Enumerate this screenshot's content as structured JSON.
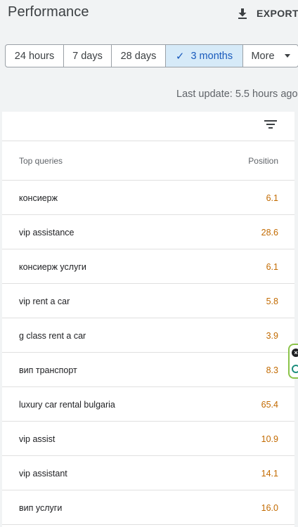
{
  "header": {
    "title": "Performance",
    "export_label": "EXPORT",
    "export_icon": "download-icon"
  },
  "date_range": {
    "options": [
      {
        "label": "24 hours",
        "selected": false
      },
      {
        "label": "7 days",
        "selected": false
      },
      {
        "label": "28 days",
        "selected": false
      },
      {
        "label": "3 months",
        "selected": true
      },
      {
        "label": "More",
        "selected": false
      }
    ],
    "check_glyph": "✓",
    "more_icon": "caret-down-icon"
  },
  "last_update": "Last update: 5.5 hours ago",
  "table": {
    "filter_icon": "filter-icon",
    "columns": {
      "query": "Top queries",
      "position": "Position"
    },
    "rows": [
      {
        "query": "консиерж",
        "position": "6.1"
      },
      {
        "query": "vip assistance",
        "position": "28.6"
      },
      {
        "query": "консиерж услуги",
        "position": "6.1"
      },
      {
        "query": "vip rent a car",
        "position": "5.8"
      },
      {
        "query": "g class rent a car",
        "position": "3.9"
      },
      {
        "query": "вип транспорт",
        "position": "8.3"
      },
      {
        "query": "luxury car rental bulgaria",
        "position": "65.4"
      },
      {
        "query": "vip assist",
        "position": "10.9"
      },
      {
        "query": "vip assistant",
        "position": "14.1"
      },
      {
        "query": "вип услуги",
        "position": "16.0"
      }
    ]
  },
  "colors": {
    "selected_bg": "#d6eaf8",
    "selected_text": "#185abc",
    "position_text": "#c26a00",
    "extension_border": "#8bc34a"
  }
}
